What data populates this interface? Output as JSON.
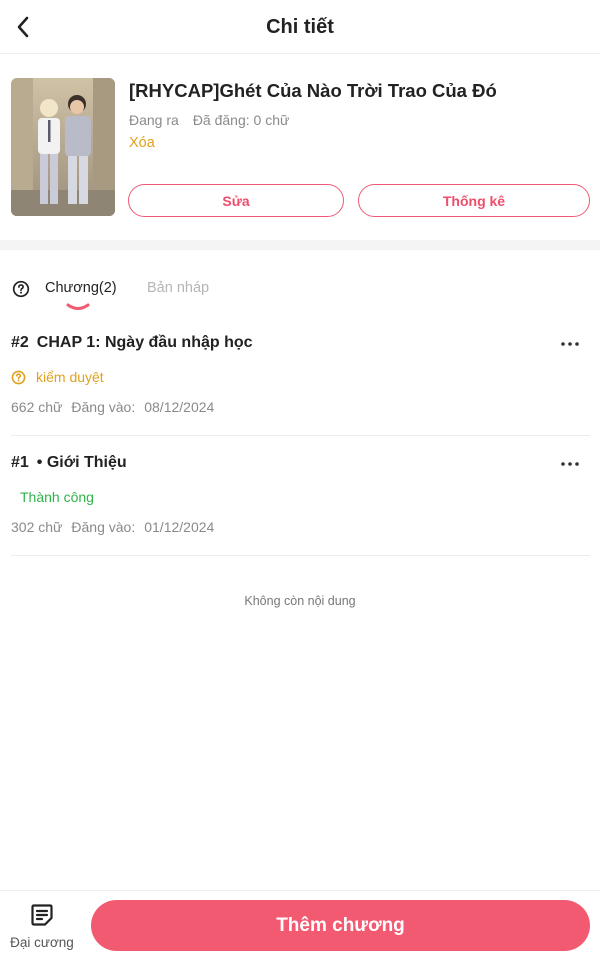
{
  "header": {
    "title": "Chi tiết",
    "back_icon": "chevron-left-icon"
  },
  "story": {
    "title": "[RHYCAP]Ghét Của Nào Trời Trao Của Đó",
    "status": "Đang ra",
    "posted": "Đã đăng: 0 chữ",
    "delete_label": "Xóa",
    "edit_label": "Sửa",
    "stats_label": "Thống kê"
  },
  "tabs": {
    "help_icon": "question-circle-icon",
    "chapters_label": "Chương(2)",
    "drafts_label": "Bản nháp",
    "active": "chapters"
  },
  "chapters": [
    {
      "number": "#2",
      "title": "CHAP 1: Ngày đầu nhập học",
      "status": "kiểm duyệt",
      "status_type": "review",
      "words": "662 chữ",
      "date_label": "Đăng vào:",
      "date": "08/12/2024"
    },
    {
      "number": "#1",
      "title": "• Giới Thiệu",
      "status": "Thành công",
      "status_type": "success",
      "words": "302 chữ",
      "date_label": "Đăng vào:",
      "date": "01/12/2024"
    }
  ],
  "end_note": "Không còn nội dung",
  "bottom": {
    "outline_label": "Đại cương",
    "outline_icon": "document-lines-icon",
    "add_chapter_label": "Thêm chương"
  },
  "colors": {
    "accent": "#f25a72",
    "warning": "#e0a11d",
    "success": "#2fb44a"
  }
}
